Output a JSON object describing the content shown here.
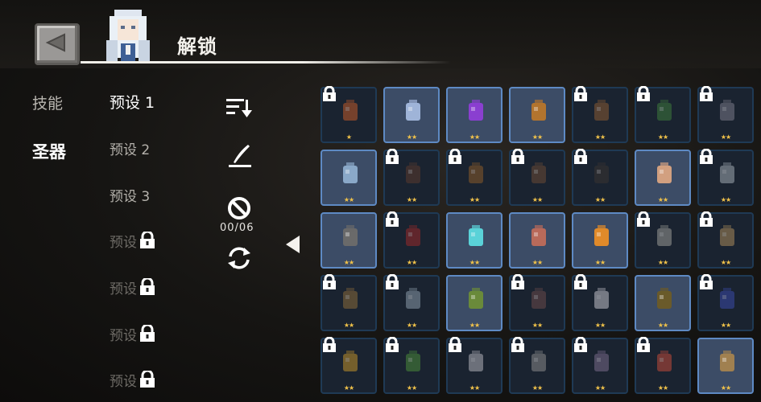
{
  "header": {
    "title": "解锁"
  },
  "categories": [
    {
      "label": "技能"
    },
    {
      "label": "圣器"
    }
  ],
  "presets": [
    {
      "label": "预设 1"
    },
    {
      "label": "预设 2"
    },
    {
      "label": "预设 3"
    },
    {
      "label": "预设"
    },
    {
      "label": "预设"
    },
    {
      "label": "预设"
    },
    {
      "label": "预设"
    }
  ],
  "tools": {
    "count": "00/06"
  },
  "colors": {
    "unlocked_border": "#5e8ac4",
    "locked_border": "#1f3a55",
    "star": "#f0c24a"
  },
  "relics": [
    {
      "stars": "★",
      "locked": true,
      "icon": "ember-icon"
    },
    {
      "stars": "★★",
      "locked": false,
      "icon": "crystal-crown-icon"
    },
    {
      "stars": "★★",
      "locked": false,
      "icon": "purple-feather-icon"
    },
    {
      "stars": "★★",
      "locked": false,
      "icon": "flask-icon"
    },
    {
      "stars": "★★",
      "locked": true,
      "icon": "fist-icon"
    },
    {
      "stars": "★★",
      "locked": true,
      "icon": "green-book-icon"
    },
    {
      "stars": "★★",
      "locked": true,
      "icon": "statue-icon"
    },
    {
      "stars": "★★",
      "locked": false,
      "icon": "ice-shard-icon"
    },
    {
      "stars": "★★",
      "locked": true,
      "icon": "dark-cloak-icon"
    },
    {
      "stars": "★★",
      "locked": true,
      "icon": "round-shield-icon"
    },
    {
      "stars": "★★",
      "locked": true,
      "icon": "sword-icon"
    },
    {
      "stars": "★★",
      "locked": true,
      "icon": "dark-feather-icon"
    },
    {
      "stars": "★★",
      "locked": false,
      "icon": "figurine-icon"
    },
    {
      "stars": "★★",
      "locked": true,
      "icon": "snowflake-icon"
    },
    {
      "stars": "★★",
      "locked": false,
      "icon": "skull-staff-icon"
    },
    {
      "stars": "★★",
      "locked": true,
      "icon": "red-scarf-icon"
    },
    {
      "stars": "★★",
      "locked": false,
      "icon": "mirror-icon"
    },
    {
      "stars": "★★",
      "locked": false,
      "icon": "meat-icon"
    },
    {
      "stars": "★★",
      "locked": false,
      "icon": "fire-orb-icon"
    },
    {
      "stars": "★★",
      "locked": true,
      "icon": "scroll-icon"
    },
    {
      "stars": "★★",
      "locked": true,
      "icon": "boot-icon"
    },
    {
      "stars": "★★",
      "locked": true,
      "icon": "mask-icon"
    },
    {
      "stars": "★★",
      "locked": true,
      "icon": "ore-icon"
    },
    {
      "stars": "★★",
      "locked": false,
      "icon": "egg-nest-icon"
    },
    {
      "stars": "★★",
      "locked": true,
      "icon": "spinner-icon"
    },
    {
      "stars": "★★",
      "locked": true,
      "icon": "crescent-icon"
    },
    {
      "stars": "★★",
      "locked": false,
      "icon": "coat-icon"
    },
    {
      "stars": "★★",
      "locked": true,
      "icon": "flag-icon"
    },
    {
      "stars": "★★",
      "locked": true,
      "icon": "medal-icon"
    },
    {
      "stars": "★★",
      "locked": true,
      "icon": "leaf-icon"
    },
    {
      "stars": "★★",
      "locked": true,
      "icon": "flower-icon"
    },
    {
      "stars": "★★",
      "locked": true,
      "icon": "smoke-icon"
    },
    {
      "stars": "★★",
      "locked": true,
      "icon": "rock-icon"
    },
    {
      "stars": "★★",
      "locked": true,
      "icon": "jar-icon"
    },
    {
      "stars": "★★",
      "locked": false,
      "icon": "peace-emblem-icon"
    }
  ]
}
